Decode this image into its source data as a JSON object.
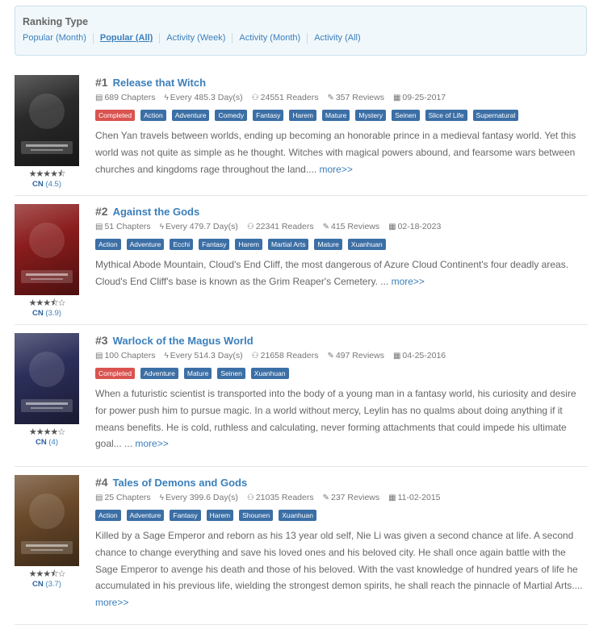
{
  "ranking": {
    "title": "Ranking Type",
    "tabs": [
      "Popular (Month)",
      "Popular (All)",
      "Activity (Week)",
      "Activity (Month)",
      "Activity (All)"
    ],
    "active_tab": "Popular (All)"
  },
  "entries": [
    {
      "rank": "#1",
      "title": "Release that Witch",
      "chapters": "689 Chapters",
      "frequency": "Every 485.3 Day(s)",
      "readers": "24551 Readers",
      "reviews": "357 Reviews",
      "date": "09-25-2017",
      "tags": [
        "Completed",
        "Action",
        "Adventure",
        "Comedy",
        "Fantasy",
        "Harem",
        "Mature",
        "Mystery",
        "Seinen",
        "Slice of Life",
        "Supernatural"
      ],
      "description": "Chen Yan travels between worlds, ending up becoming an honorable prince in a medieval fantasy world. Yet this world was not quite as simple as he thought. Witches with magical powers abound, and fearsome wars between churches and kingdoms rage throughout the land....",
      "more": "more>>",
      "stars": "★★★★⯪",
      "origin": "CN",
      "score": "(4.5)",
      "cover_color": "#2a2a2a"
    },
    {
      "rank": "#2",
      "title": "Against the Gods",
      "chapters": "51 Chapters",
      "frequency": "Every 479.7 Day(s)",
      "readers": "22341 Readers",
      "reviews": "415 Reviews",
      "date": "02-18-2023",
      "tags": [
        "Action",
        "Adventure",
        "Ecchi",
        "Fantasy",
        "Harem",
        "Martial Arts",
        "Mature",
        "Xuanhuan"
      ],
      "description": "Mythical Abode Mountain, Cloud's End Cliff, the most dangerous of Azure Cloud Continent's four deadly areas. Cloud's End Cliff's base is known as the Grim Reaper's Cemetery. ...",
      "more": "more>>",
      "stars": "★★★⯪☆",
      "origin": "CN",
      "score": "(3.9)",
      "cover_color": "#8a1c1c"
    },
    {
      "rank": "#3",
      "title": "Warlock of the Magus World",
      "chapters": "100 Chapters",
      "frequency": "Every 514.3 Day(s)",
      "readers": "21658 Readers",
      "reviews": "497 Reviews",
      "date": "04-25-2016",
      "tags": [
        "Completed",
        "Adventure",
        "Mature",
        "Seinen",
        "Xuanhuan"
      ],
      "description": "When a futuristic scientist is transported into the body of a young man in a fantasy world, his curiosity and desire for power push him to pursue magic. In a world without mercy, Leylin has no qualms about doing anything if it means benefits. He is cold, ruthless and calculating, never forming attachments that could impede his ultimate goal... ...",
      "more": "more>>",
      "stars": "★★★★☆",
      "origin": "CN",
      "score": "(4)",
      "cover_color": "#2c2f5a"
    },
    {
      "rank": "#4",
      "title": "Tales of Demons and Gods",
      "chapters": "25 Chapters",
      "frequency": "Every 399.6 Day(s)",
      "readers": "21035 Readers",
      "reviews": "237 Reviews",
      "date": "11-02-2015",
      "tags": [
        "Action",
        "Adventure",
        "Fantasy",
        "Harem",
        "Shounen",
        "Xuanhuan"
      ],
      "description": "Killed by a Sage Emperor and reborn as his 13 year old self, Nie Li was given a second chance at life. A second chance to change everything and save his loved ones and his beloved city. He shall once again battle with the Sage Emperor to avenge his death and those of his beloved. With the vast knowledge of hundred years of life he accumulated in his previous life, wielding the strongest demon spirits, he shall reach the pinnacle of Martial Arts....",
      "more": "more>>",
      "stars": "★★★⯪☆",
      "origin": "CN",
      "score": "(3.7)",
      "cover_color": "#6b4a2a"
    }
  ]
}
